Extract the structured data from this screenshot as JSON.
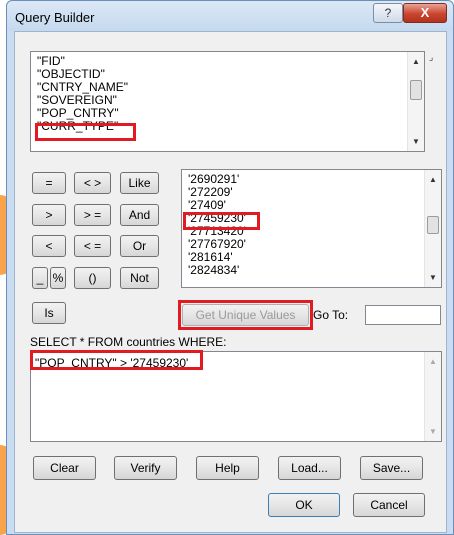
{
  "window": {
    "title": "Query Builder"
  },
  "titlebar": {
    "help": "?",
    "close": "X"
  },
  "fields": {
    "items": [
      "\"FID\"",
      "\"OBJECTID\"",
      "\"CNTRY_NAME\"",
      "\"SOVEREIGN\"",
      "\"POP_CNTRY\"",
      "\"CURR_TYPE\""
    ],
    "selected": "\"POP_CNTRY\""
  },
  "operators": {
    "eq": "=",
    "ne": "< >",
    "like": "Like",
    "gt": ">",
    "ge": "> =",
    "and": "And",
    "lt": "<",
    "le": "< =",
    "or": "Or",
    "underscore": "_",
    "percent": "%",
    "parens": "()",
    "not": "Not",
    "is": "Is"
  },
  "values": {
    "items": [
      "'2690291'",
      "'272209'",
      "'27409'",
      "'27459230'",
      "'27713420'",
      "'27767920'",
      "'281614'",
      "'2824834'"
    ],
    "selected": "'27459230'"
  },
  "unique": {
    "get_unique_values": "Get Unique Values",
    "goto_label": "Go To:",
    "goto_value": ""
  },
  "where": {
    "label": "SELECT * FROM countries WHERE:",
    "expression": "\"POP_CNTRY\" > '27459230'"
  },
  "actions": {
    "clear": "Clear",
    "verify": "Verify",
    "help": "Help",
    "load": "Load...",
    "save": "Save..."
  },
  "dialog": {
    "ok": "OK",
    "cancel": "Cancel"
  },
  "colors": {
    "highlight": "#e21b23",
    "accent_orange": "#f7a44a"
  }
}
